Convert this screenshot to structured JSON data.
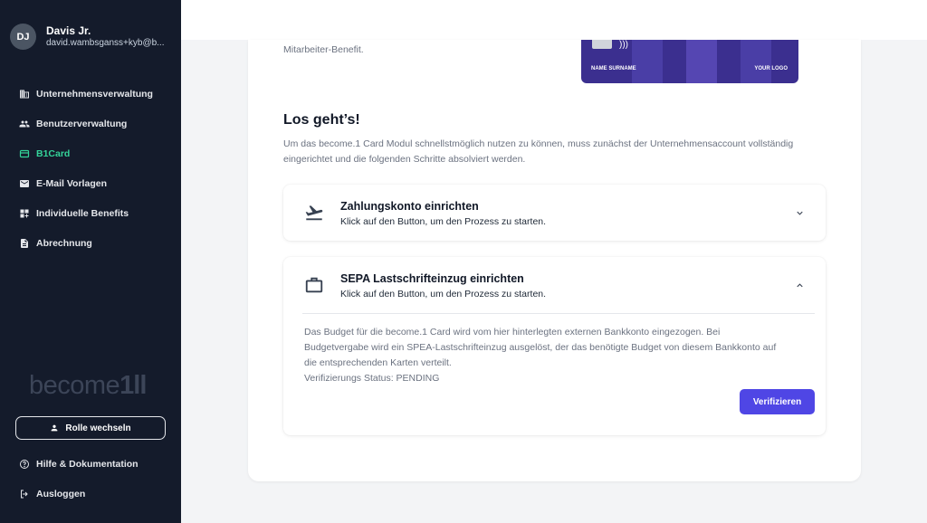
{
  "user": {
    "initials": "DJ",
    "name": "Davis Jr.",
    "email": "david.wambsganss+kyb@b..."
  },
  "nav": [
    {
      "label": "Unternehmensverwaltung",
      "icon": "building-icon"
    },
    {
      "label": "Benutzerverwaltung",
      "icon": "users-icon"
    },
    {
      "label": "B1Card",
      "icon": "credit-card-icon",
      "active": true
    },
    {
      "label": "E-Mail Vorlagen",
      "icon": "mail-icon"
    },
    {
      "label": "Individuelle Benefits",
      "icon": "dashboard-add-icon"
    },
    {
      "label": "Abrechnung",
      "icon": "document-icon"
    }
  ],
  "brand": {
    "text": "become",
    "mark": "1ll"
  },
  "role_button": "Rolle wechseln",
  "footer": {
    "help": "Hilfe & Dokumentation",
    "logout": "Ausloggen"
  },
  "main": {
    "benefit_text": "Mitarbeiter-Benefit.",
    "card": {
      "name": "NAME SURNAME",
      "logo": "YOUR LOGO"
    },
    "title": "Los geht’s!",
    "description": "Um das become.1 Card Modul schnellstmöglich nutzen zu können, muss zunächst der Unternehmensaccount vollständig eingerichtet und die folgenden Schritte absolviert werden.",
    "steps": [
      {
        "title": "Zahlungskonto einrichten",
        "subtitle": "Klick auf den Button, um den Prozess zu starten.",
        "icon": "flight-takeoff-icon",
        "expanded": false
      },
      {
        "title": "SEPA Lastschrifteinzug einrichten",
        "subtitle": "Klick auf den Button, um den Prozess zu starten.",
        "icon": "briefcase-icon",
        "expanded": true,
        "body": "Das Budget für die become.1 Card wird vom hier hinterlegten externen Bankkonto eingezogen. Bei Budgetvergabe wird ein SPEA-Lastschrifteinzug ausgelöst, der das benötigte Budget von diesem Bankkonto auf die entsprechenden Karten verteilt.",
        "status": "Verifizierungs Status: PENDING",
        "button": "Verifizieren"
      }
    ]
  },
  "colors": {
    "sidebar": "#141b2b",
    "active": "#34d399",
    "accent": "#4f46e5",
    "card": "#3b2f8f"
  }
}
